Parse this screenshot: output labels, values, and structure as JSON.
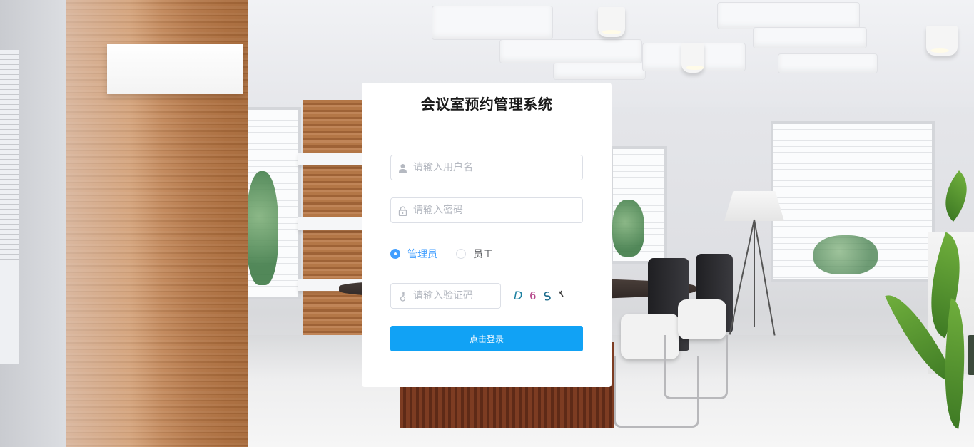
{
  "login": {
    "title": "会议室预约管理系统",
    "username": {
      "placeholder": "请输入用户名",
      "value": "",
      "icon": "user-icon"
    },
    "password": {
      "placeholder": "请输入密码",
      "value": "",
      "icon": "lock-icon"
    },
    "roles": [
      {
        "label": "管理员",
        "checked": true
      },
      {
        "label": "员工",
        "checked": false
      }
    ],
    "captcha": {
      "placeholder": "请输入验证码",
      "value": "",
      "icon": "key-icon",
      "chars": [
        "D",
        "6",
        "S"
      ]
    },
    "submit_label": "点击登录"
  },
  "colors": {
    "primary": "#409eff",
    "button": "#11a2f5",
    "captcha_chars": [
      "#1a7fa0",
      "#b5468a",
      "#1a6a8a"
    ]
  }
}
